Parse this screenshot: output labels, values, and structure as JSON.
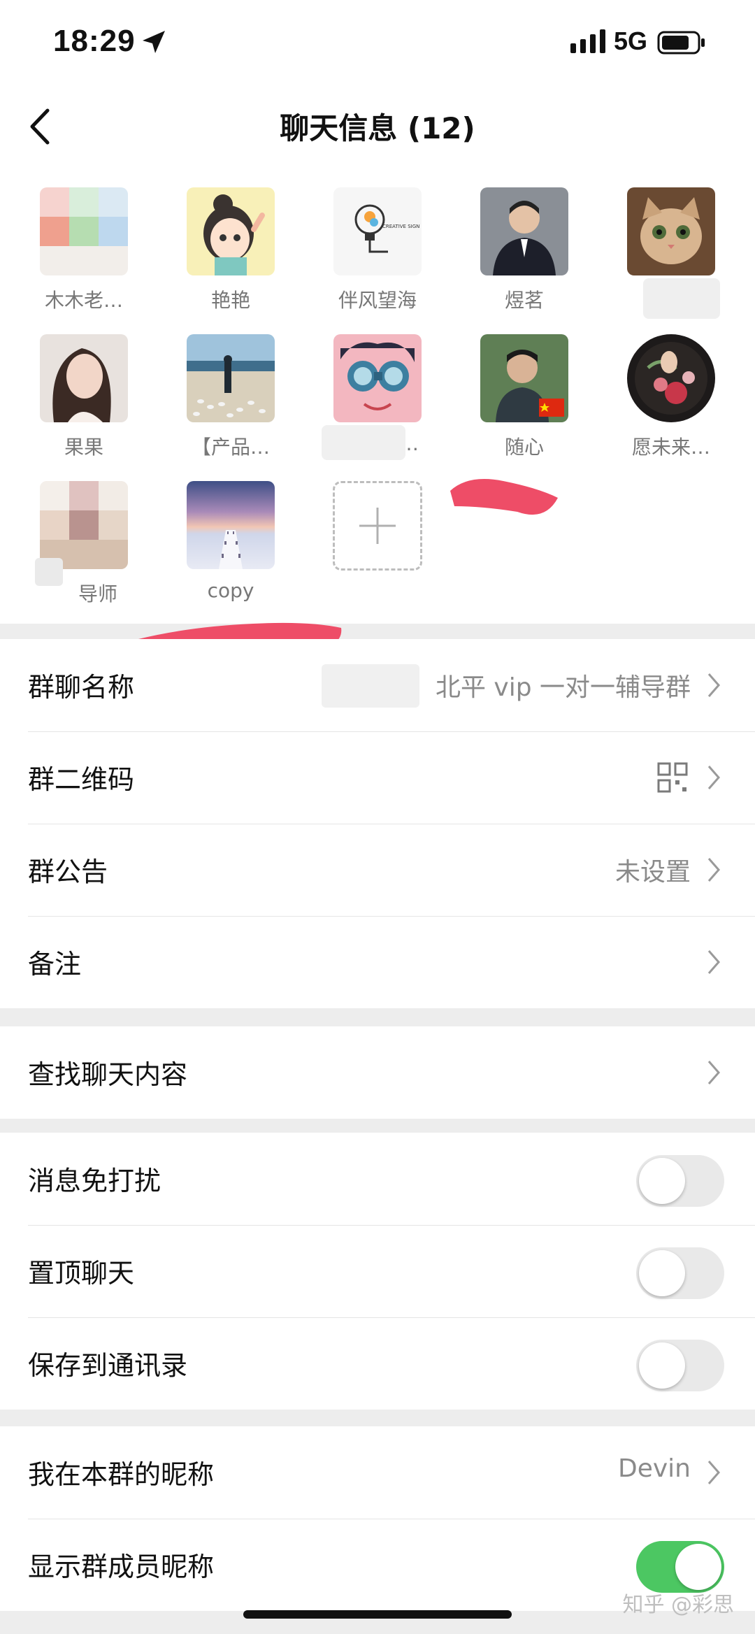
{
  "status_bar": {
    "time": "18:29",
    "network": "5G"
  },
  "nav": {
    "title": "聊天信息 (12)"
  },
  "members": [
    {
      "name": "木木老…",
      "avatar": "mosaic-blurred-avatar"
    },
    {
      "name": "艳艳",
      "avatar": "cartoon-girl-avatar"
    },
    {
      "name": "伴风望海",
      "avatar": "lightbulb-logo-avatar"
    },
    {
      "name": "煜茗",
      "avatar": "man-in-suit-avatar"
    },
    {
      "name": "",
      "avatar": "cat-avatar"
    },
    {
      "name": "果果",
      "avatar": "woman-portrait-avatar"
    },
    {
      "name": "【产品…",
      "avatar": "beach-birds-avatar"
    },
    {
      "name": "…",
      "avatar": "cartoon-binoculars-avatar"
    },
    {
      "name": "随心",
      "avatar": "man-flag-avatar"
    },
    {
      "name": "愿未来…",
      "avatar": "floral-art-avatar"
    },
    {
      "name": "导师",
      "avatar": "blurred-person-avatar"
    },
    {
      "name": "copy",
      "avatar": "pier-sunset-avatar"
    }
  ],
  "settings": {
    "group_name": {
      "label": "群聊名称",
      "value": "北平 vip 一对一辅导群"
    },
    "group_qr": {
      "label": "群二维码"
    },
    "announcement": {
      "label": "群公告",
      "value": "未设置"
    },
    "remark": {
      "label": "备注"
    },
    "search_chat": {
      "label": "查找聊天内容"
    },
    "mute": {
      "label": "消息免打扰",
      "on": false
    },
    "pin_top": {
      "label": "置顶聊天",
      "on": false
    },
    "save_contacts": {
      "label": "保存到通讯录",
      "on": false
    },
    "my_nickname": {
      "label": "我在本群的昵称",
      "value": "Devin"
    },
    "show_nicknames": {
      "label": "显示群成员昵称",
      "on": true
    }
  },
  "colors": {
    "toggle_on": "#4cc762",
    "toggle_off": "#e9e9e9",
    "scribble": "#ee4d67"
  },
  "watermark": "知乎 @彩思"
}
